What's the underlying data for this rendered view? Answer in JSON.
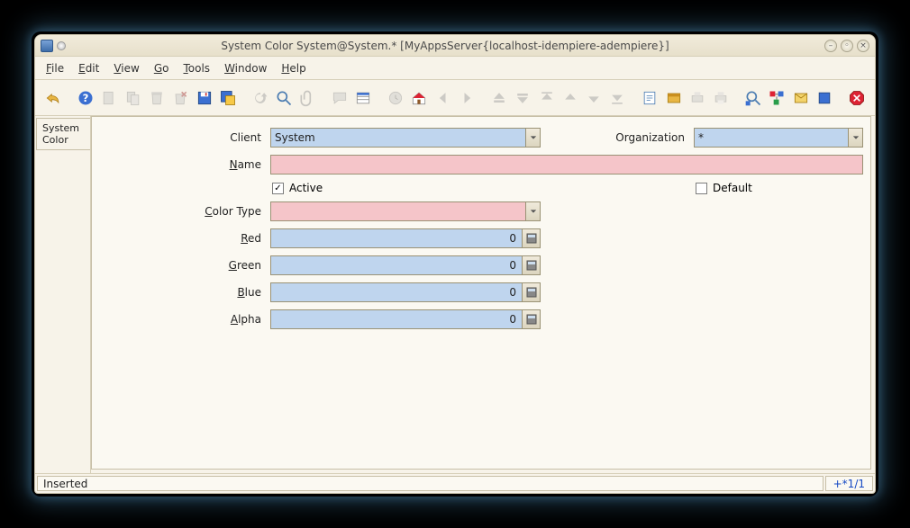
{
  "window": {
    "title": "System Color  System@System.* [MyAppsServer{localhost-idempiere-adempiere}]"
  },
  "menu": {
    "file": "File",
    "edit": "Edit",
    "view": "View",
    "go": "Go",
    "tools": "Tools",
    "window": "Window",
    "help": "Help"
  },
  "tab": {
    "label": "System\nColor"
  },
  "form": {
    "client_label": "Client",
    "client_value": "System",
    "org_label": "Organization",
    "org_value": "*",
    "name_label": "Name",
    "name_value": "",
    "active_label": "Active",
    "active_checked": true,
    "default_label": "Default",
    "default_checked": false,
    "colortype_label": "Color Type",
    "colortype_value": "",
    "red_label": "Red",
    "red_value": "0",
    "green_label": "Green",
    "green_value": "0",
    "blue_label": "Blue",
    "blue_value": "0",
    "alpha_label": "Alpha",
    "alpha_value": "0"
  },
  "status": {
    "left": "Inserted",
    "right": "+*1/1"
  }
}
